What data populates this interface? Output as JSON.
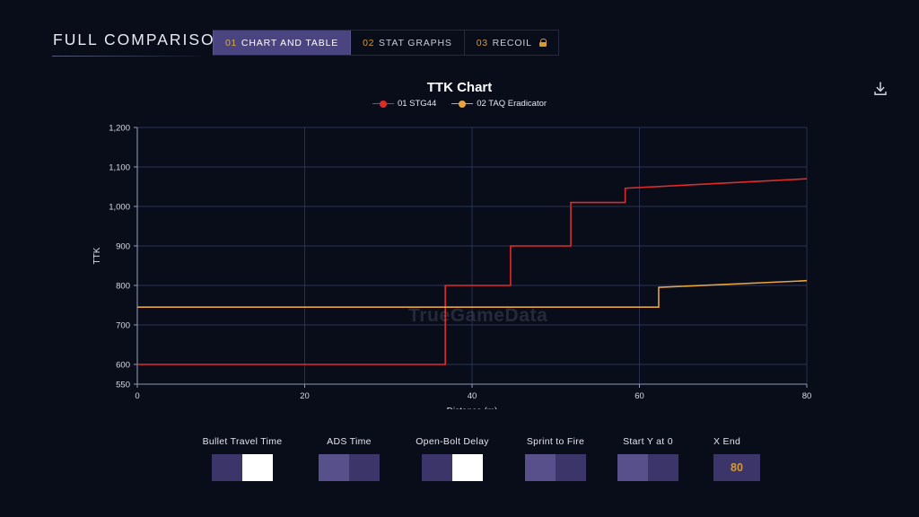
{
  "header": {
    "title": "FULL COMPARISON",
    "tabs": [
      {
        "num": "01",
        "label": "CHART AND TABLE",
        "active": true,
        "locked": false
      },
      {
        "num": "02",
        "label": "STAT GRAPHS",
        "active": false,
        "locked": false
      },
      {
        "num": "03",
        "label": "RECOIL",
        "active": false,
        "locked": true
      }
    ],
    "download_icon": "download-icon"
  },
  "watermark": "TrueGameData",
  "colors": {
    "background": "#090d1a",
    "accent_gold": "#d89a2e",
    "tab_active": "#4a4580",
    "series_1": "#e02b2b",
    "series_2": "#e8a33d",
    "grid": "#2a3352",
    "toggle_track": "#3b3569",
    "toggle_knob_on": "#ffffff",
    "toggle_knob_off": "#57508a"
  },
  "chart_data": {
    "type": "line",
    "title": "TTK Chart",
    "xlabel": "Distance (m)",
    "ylabel": "TTK",
    "xlim": [
      0,
      80
    ],
    "ylim": [
      550,
      1200
    ],
    "xticks": [
      0,
      20,
      40,
      60,
      80
    ],
    "xticklabels": [
      "0",
      "20",
      "40",
      "60",
      "80"
    ],
    "yticks": [
      550,
      600,
      700,
      800,
      900,
      1000,
      1100,
      1200
    ],
    "yticklabels": [
      "550",
      "600",
      "700",
      "800",
      "900",
      "1,000",
      "1,100",
      "1,200"
    ],
    "grid": true,
    "legend_position": "top-center",
    "step_style": "post",
    "series": [
      {
        "name": "01 STG44",
        "color": "#e02b2b",
        "x": [
          0,
          36.8,
          36.8,
          44.6,
          44.6,
          51.8,
          51.8,
          58.3,
          58.3,
          80
        ],
        "values": [
          600,
          600,
          800,
          800,
          900,
          900,
          1010,
          1010,
          1046,
          1070
        ]
      },
      {
        "name": "02 TAQ Eradicator",
        "color": "#e8a33d",
        "x": [
          0,
          62.3,
          62.3,
          80
        ],
        "values": [
          745,
          745,
          795,
          812
        ]
      }
    ]
  },
  "controls": [
    {
      "name": "bullet-travel-time",
      "label": "Bullet Travel Time",
      "type": "toggle",
      "state": "on"
    },
    {
      "name": "ads-time",
      "label": "ADS Time",
      "type": "toggle",
      "state": "off"
    },
    {
      "name": "open-bolt-delay",
      "label": "Open-Bolt Delay",
      "type": "toggle",
      "state": "on"
    },
    {
      "name": "sprint-to-fire",
      "label": "Sprint to Fire",
      "type": "toggle",
      "state": "off"
    },
    {
      "name": "start-y-at-0",
      "label": "Start Y at 0",
      "type": "toggle",
      "state": "off"
    },
    {
      "name": "x-end",
      "label": "X End",
      "type": "number",
      "value": "80"
    }
  ]
}
